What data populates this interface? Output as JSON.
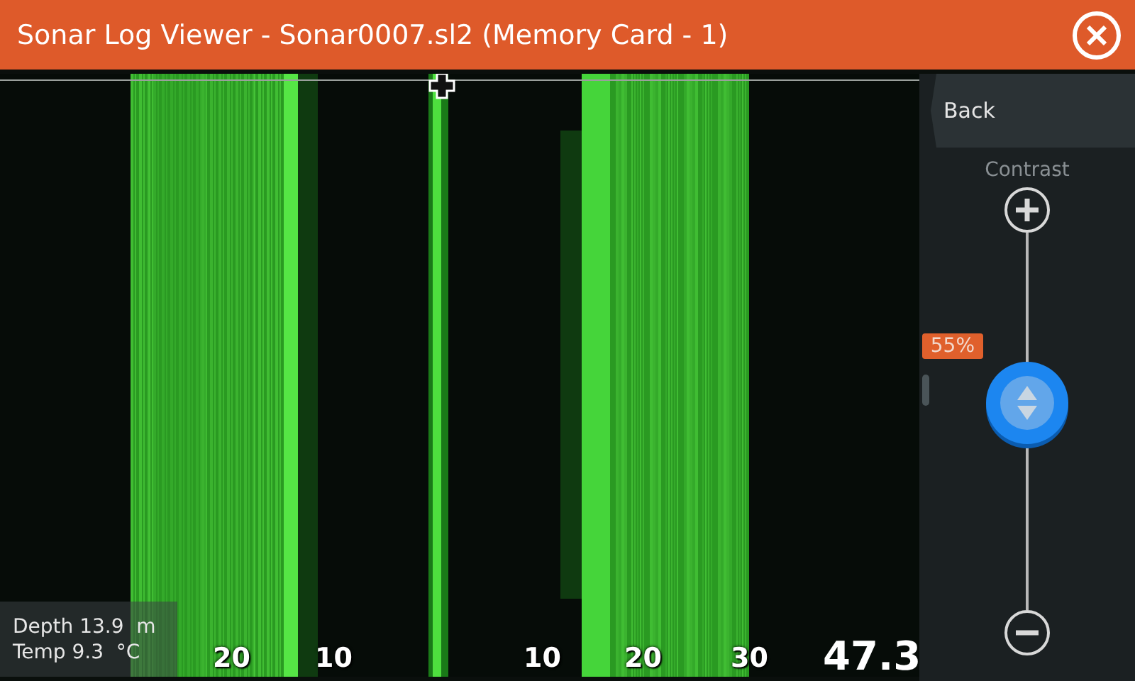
{
  "window": {
    "title": "Sonar Log Viewer - Sonar0007.sl2 (Memory Card - 1)"
  },
  "sonar": {
    "range_labels": [
      "20",
      "10",
      "10",
      "20",
      "30"
    ],
    "speed": "47.3",
    "readouts": [
      {
        "label": "Depth",
        "value": "13.9",
        "unit": "m"
      },
      {
        "label": "Temp",
        "value": "9.3",
        "unit": "°C"
      }
    ]
  },
  "panel": {
    "back": "Back",
    "contrast": {
      "label": "Contrast",
      "level": 0.55,
      "reading": "55%"
    }
  }
}
